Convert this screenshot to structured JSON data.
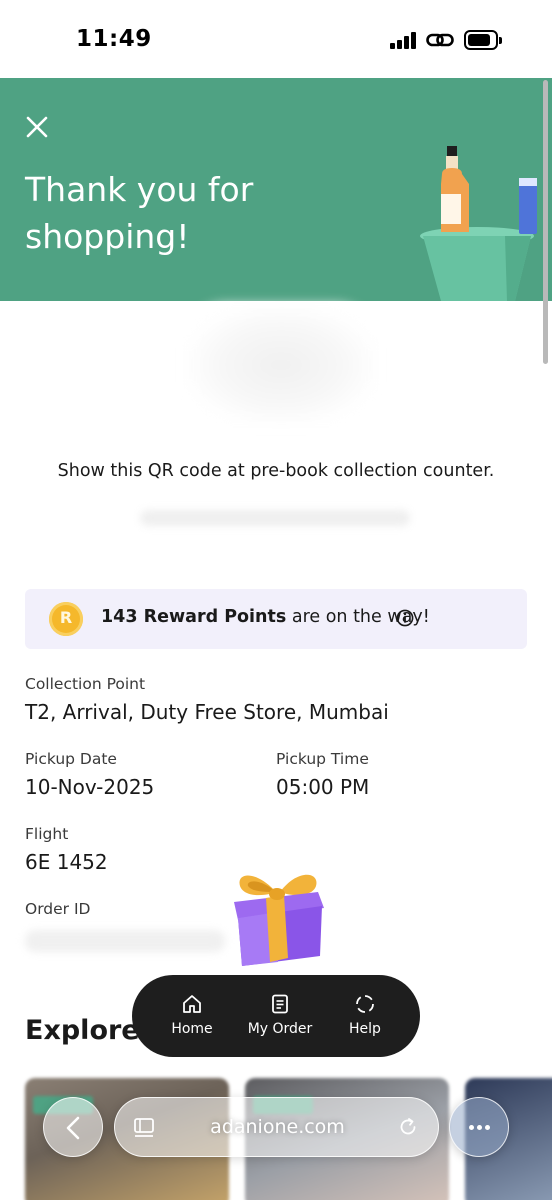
{
  "status_bar": {
    "time": "11:49"
  },
  "header": {
    "title_line1": "Thank you for",
    "title_line2": "shopping!",
    "accent_color": "#4fa283"
  },
  "qr": {
    "caption": "Show this QR code at pre-book collection counter."
  },
  "reward": {
    "coin_letter": "R",
    "points_text": "143 Reward Points",
    "suffix_text": " are on the way!"
  },
  "details": {
    "collection_point_label": "Collection Point",
    "collection_point_value": "T2, Arrival, Duty Free Store, Mumbai",
    "pickup_date_label": "Pickup Date",
    "pickup_date_value": "10-Nov-2025",
    "pickup_time_label": "Pickup Time",
    "pickup_time_value": "05:00 PM",
    "flight_label": "Flight",
    "flight_value": "6E 1452",
    "order_id_label": "Order ID"
  },
  "explore": {
    "title": "Explore c"
  },
  "floating_nav": {
    "items": [
      {
        "label": "Home",
        "icon": "home-icon"
      },
      {
        "label": "My Order",
        "icon": "receipt-icon"
      },
      {
        "label": "Help",
        "icon": "help-icon"
      }
    ]
  },
  "browser": {
    "url": "adanione.com"
  }
}
